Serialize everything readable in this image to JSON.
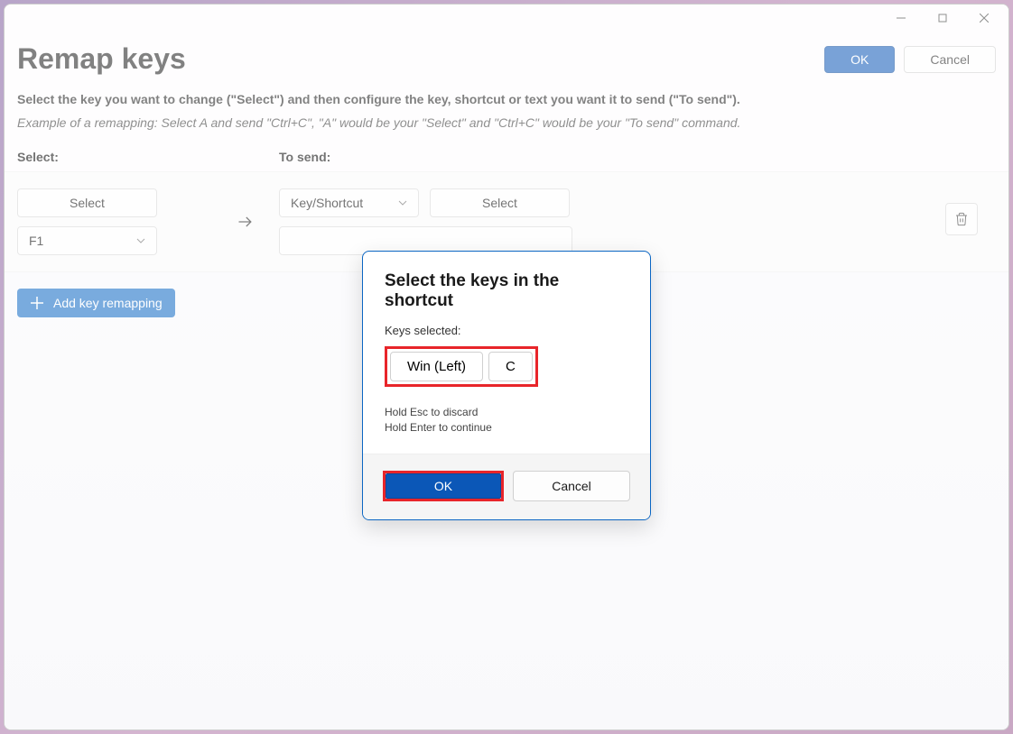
{
  "window": {
    "title": "Remap keys",
    "ok_label": "OK",
    "cancel_label": "Cancel"
  },
  "instructions": {
    "line1": "Select the key you want to change (\"Select\") and then configure the key, shortcut or text you want it to send (\"To send\").",
    "line2": "Example of a remapping: Select A and send \"Ctrl+C\", \"A\" would be your \"Select\" and \"Ctrl+C\" would be your \"To send\" command."
  },
  "columns": {
    "select": "Select:",
    "send": "To send:"
  },
  "row": {
    "select_btn": "Select",
    "key_value": "F1",
    "send_type": "Key/Shortcut",
    "send_select_btn": "Select"
  },
  "add_button": "Add key remapping",
  "dialog": {
    "title": "Select the keys in the shortcut",
    "label": "Keys selected:",
    "keys": [
      "Win (Left)",
      "C"
    ],
    "hint1": "Hold Esc to discard",
    "hint2": "Hold Enter to continue",
    "ok": "OK",
    "cancel": "Cancel"
  }
}
